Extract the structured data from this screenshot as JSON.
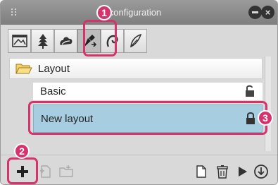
{
  "window": {
    "title": "ct configuration"
  },
  "tabs": [
    {
      "icon": "canvas-frame-icon"
    },
    {
      "icon": "tree-icon"
    },
    {
      "icon": "cloud-brush-icon"
    },
    {
      "icon": "pen-arrow-icon",
      "active": true
    },
    {
      "icon": "swirl-icon"
    },
    {
      "icon": "feather-pen-icon"
    }
  ],
  "list": {
    "group_label": "Layout",
    "items": [
      {
        "label": "Basic"
      },
      {
        "label": "New layout",
        "selected": true
      }
    ]
  },
  "callouts": {
    "one": "1",
    "two": "2",
    "three": "3"
  },
  "colors": {
    "highlight": "#d6336c",
    "selection": "#a7cde0",
    "titlebar": "#8a8a8a"
  }
}
